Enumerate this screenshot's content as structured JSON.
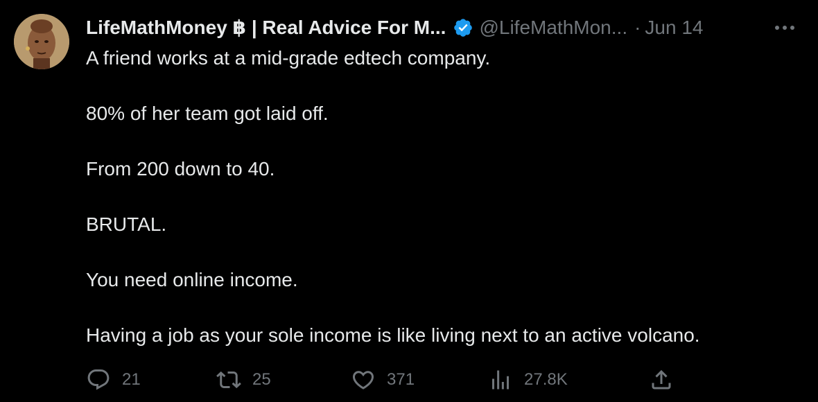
{
  "author": {
    "display_name": "LifeMathMoney ฿ | Real Advice For M...",
    "handle": "@LifeMathMon...",
    "separator": "·",
    "date": "Jun 14",
    "avatar_icon": "portrait-avatar",
    "verified_icon": "verified-badge-icon"
  },
  "tweet": {
    "paragraphs": [
      "A friend works at a mid-grade edtech company.",
      "80% of her team got laid off.",
      "From 200 down to 40.",
      "BRUTAL.",
      "You need online income.",
      "Having a job as your sole income is like living next to an active volcano."
    ]
  },
  "actions": {
    "reply_count": "21",
    "retweet_count": "25",
    "like_count": "371",
    "view_count": "27.8K"
  },
  "colors": {
    "background": "#000000",
    "text": "#e7e9ea",
    "muted": "#71767b",
    "verified": "#1d9bf0"
  }
}
